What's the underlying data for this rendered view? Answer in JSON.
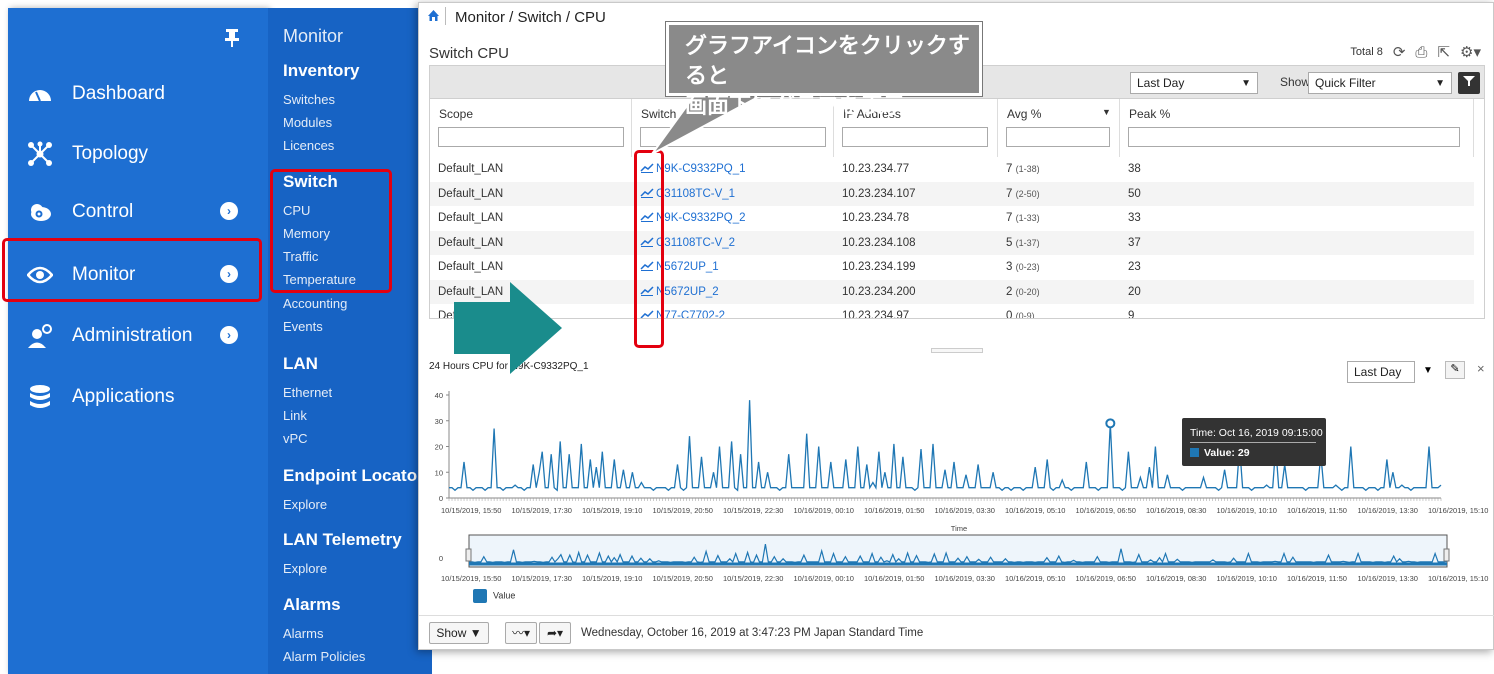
{
  "nav": {
    "items": [
      {
        "label": "Dashboard",
        "icon": "gauge-icon"
      },
      {
        "label": "Topology",
        "icon": "topology-icon"
      },
      {
        "label": "Control",
        "icon": "cloud-gear-icon"
      },
      {
        "label": "Monitor",
        "icon": "eye-icon"
      },
      {
        "label": "Administration",
        "icon": "user-gear-icon"
      },
      {
        "label": "Applications",
        "icon": "database-icon"
      }
    ]
  },
  "submenu": {
    "top": "Monitor",
    "inventory": {
      "heading": "Inventory",
      "items": [
        "Switches",
        "Modules",
        "Licences"
      ]
    },
    "switch": {
      "heading": "Switch",
      "items": [
        "CPU",
        "Memory",
        "Traffic",
        "Temperature",
        "Accounting",
        "Events"
      ]
    },
    "lan": {
      "heading": "LAN",
      "items": [
        "Ethernet",
        "Link",
        "vPC"
      ]
    },
    "endpoint": {
      "heading": "Endpoint Locator",
      "items": [
        "Explore"
      ]
    },
    "telemetry": {
      "heading": "LAN Telemetry",
      "items": [
        "Explore"
      ]
    },
    "alarms": {
      "heading": "Alarms",
      "items": [
        "Alarms",
        "Alarm Policies"
      ]
    }
  },
  "breadcrumb": "Monitor / Switch / CPU",
  "page_title": "Switch CPU",
  "toolbar": {
    "total": "Total 8",
    "range": "Last Day",
    "show_label": "Show",
    "filter": "Quick Filter"
  },
  "table": {
    "headers": [
      "Scope",
      "Switch",
      "IP Address",
      "Avg %",
      "Peak %"
    ],
    "rows": [
      {
        "scope": "Default_LAN",
        "switch": "N9K-C9332PQ_1",
        "ip": "10.23.234.77",
        "avg": "7",
        "range": "(1-38)",
        "peak": "38"
      },
      {
        "scope": "Default_LAN",
        "switch": "C31108TC-V_1",
        "ip": "10.23.234.107",
        "avg": "7",
        "range": "(2-50)",
        "peak": "50"
      },
      {
        "scope": "Default_LAN",
        "switch": "N9K-C9332PQ_2",
        "ip": "10.23.234.78",
        "avg": "7",
        "range": "(1-33)",
        "peak": "33"
      },
      {
        "scope": "Default_LAN",
        "switch": "C31108TC-V_2",
        "ip": "10.23.234.108",
        "avg": "5",
        "range": "(1-37)",
        "peak": "37"
      },
      {
        "scope": "Default_LAN",
        "switch": "N5672UP_1",
        "ip": "10.23.234.199",
        "avg": "3",
        "range": "(0-23)",
        "peak": "23"
      },
      {
        "scope": "Default_LAN",
        "switch": "N5672UP_2",
        "ip": "10.23.234.200",
        "avg": "2",
        "range": "(0-20)",
        "peak": "20"
      },
      {
        "scope": "Def",
        "switch": "N77-C7702-2",
        "ip": "10.23.234.97",
        "avg": "0",
        "range": "(0-9)",
        "peak": "9"
      }
    ]
  },
  "callout": {
    "line1": "グラフアイコンをクリックすると",
    "line2": "画面下にグラフを表示"
  },
  "chart_panel": {
    "title": "24 Hours CPU for N9K-C9332PQ_1",
    "range": "Last Day",
    "close": "×"
  },
  "tooltip": {
    "time": "Time: Oct 16, 2019 09:15:00",
    "value": "Value: 29"
  },
  "bottom": {
    "show": "Show",
    "timestamp": "Wednesday, October 16, 2019 at 3:47:23 PM Japan Standard Time"
  },
  "colors": {
    "nav": "#1e6fd2",
    "highlight": "#e3000f",
    "series": "#1f77b4",
    "arrow": "#1a8c8c"
  },
  "chart_data": {
    "type": "line",
    "xlabel": "Time",
    "ylabel": "",
    "ylim": [
      0,
      40
    ],
    "yticks": [
      0,
      10,
      20,
      30,
      40
    ],
    "xticks": [
      "10/15/2019, 15:50",
      "10/15/2019, 17:30",
      "10/15/2019, 19:10",
      "10/15/2019, 20:50",
      "10/15/2019, 22:30",
      "10/16/2019, 00:10",
      "10/16/2019, 01:50",
      "10/16/2019, 03:30",
      "10/16/2019, 05:10",
      "10/16/2019, 06:50",
      "10/16/2019, 08:30",
      "10/16/2019, 10:10",
      "10/16/2019, 11:50",
      "10/16/2019, 13:30",
      "10/16/2019, 15:10"
    ],
    "legend": [
      "Value"
    ],
    "series": [
      {
        "name": "Value",
        "values": [
          4,
          4,
          3,
          4,
          4,
          14,
          4,
          4,
          3,
          4,
          4,
          4,
          3,
          4,
          4,
          27,
          4,
          4,
          3,
          4,
          4,
          4,
          5,
          4,
          4,
          3,
          4,
          4,
          13,
          4,
          10,
          18,
          4,
          4,
          17,
          4,
          3,
          22,
          4,
          4,
          17,
          4,
          4,
          4,
          21,
          4,
          4,
          15,
          4,
          12,
          4,
          18,
          4,
          4,
          4,
          15,
          4,
          4,
          11,
          4,
          4,
          10,
          4,
          4,
          6,
          4,
          4,
          4,
          3,
          4,
          4,
          4,
          4,
          3,
          4,
          4,
          13,
          4,
          3,
          4,
          24,
          4,
          4,
          4,
          16,
          4,
          4,
          4,
          10,
          4,
          20,
          4,
          4,
          4,
          22,
          4,
          3,
          17,
          4,
          4,
          38,
          4,
          4,
          14,
          4,
          4,
          10,
          4,
          4,
          4,
          3,
          4,
          4,
          17,
          4,
          4,
          4,
          4,
          4,
          25,
          4,
          4,
          4,
          20,
          4,
          4,
          4,
          14,
          4,
          4,
          4,
          4,
          15,
          4,
          4,
          4,
          20,
          4,
          4,
          13,
          4,
          6,
          4,
          18,
          4,
          10,
          4,
          4,
          21,
          4,
          4,
          16,
          4,
          4,
          4,
          3,
          4,
          19,
          4,
          4,
          4,
          21,
          4,
          4,
          4,
          11,
          4,
          4,
          14,
          4,
          4,
          4,
          9,
          4,
          4,
          4,
          13,
          4,
          4,
          4,
          4,
          10,
          4,
          4,
          3,
          4,
          4,
          3,
          4,
          4,
          4,
          3,
          4,
          4,
          4,
          12,
          4,
          4,
          4,
          15,
          4,
          3,
          4,
          4,
          7,
          4,
          4,
          3,
          4,
          4,
          4,
          4,
          14,
          4,
          4,
          4,
          3,
          4,
          4,
          4,
          29,
          4,
          4,
          4,
          3,
          4,
          18,
          4,
          4,
          4,
          8,
          4,
          4,
          12,
          4,
          20,
          4,
          4,
          4,
          9,
          4,
          4,
          4,
          4,
          3,
          4,
          4,
          4,
          4,
          4,
          4,
          8,
          4,
          4,
          4,
          4,
          3,
          4,
          11,
          4,
          4,
          4,
          4,
          20,
          4,
          4,
          4,
          3,
          4,
          4,
          4,
          4,
          5,
          4,
          4,
          20,
          4,
          4,
          13,
          4,
          4,
          4,
          4,
          4,
          4,
          3,
          4,
          4,
          4,
          4,
          17,
          4,
          4,
          4,
          4,
          5,
          4,
          3,
          4,
          4,
          20,
          4,
          4,
          4,
          4,
          3,
          4,
          4,
          4,
          3,
          4,
          4,
          15,
          4,
          10,
          4,
          4,
          5,
          4,
          4,
          3,
          4,
          4,
          4,
          4,
          4,
          20,
          4,
          4,
          4,
          5
        ]
      }
    ]
  }
}
